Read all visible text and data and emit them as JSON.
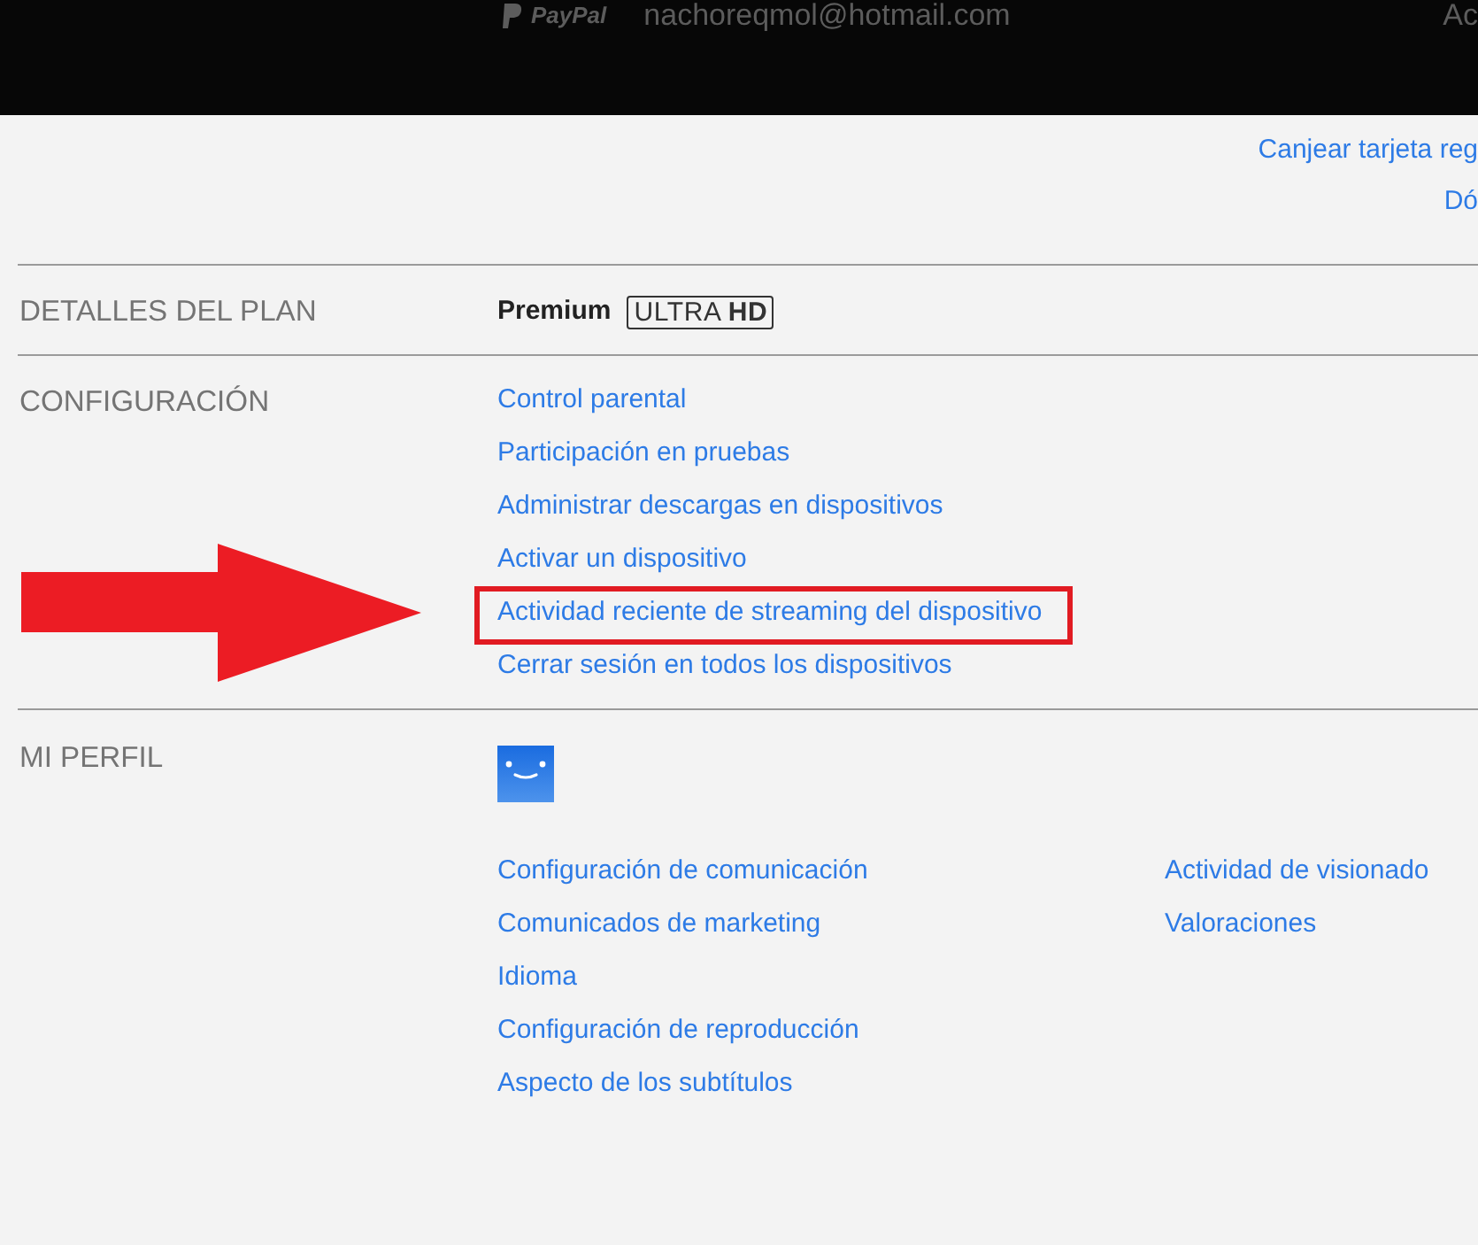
{
  "top_bar": {
    "payment_brand": "PayPal",
    "email": "nachoreqmol@hotmail.com",
    "cut_text": "Ac"
  },
  "account_links": [
    "Canjear tarjeta reg",
    "Dó"
  ],
  "plan": {
    "label": "DETALLES DEL PLAN",
    "name": "Premium",
    "badge": "ULTRA **HD**"
  },
  "settings": {
    "label": "CONFIGURACIÓN",
    "links": [
      {
        "text": "Control parental",
        "highlighted": false
      },
      {
        "text": "Participación en pruebas",
        "highlighted": false
      },
      {
        "text": "Administrar descargas en dispositivos",
        "highlighted": false
      },
      {
        "text": "Activar un dispositivo",
        "highlighted": false
      },
      {
        "text": "Actividad reciente de streaming del dispositivo",
        "highlighted": true
      },
      {
        "text": "Cerrar sesión en todos los dispositivos",
        "highlighted": false
      }
    ]
  },
  "profile": {
    "label": "MI PERFIL",
    "left_links": [
      "Configuración de comunicación",
      "Comunicados de marketing",
      "Idioma",
      "Configuración de reproducción",
      "Aspecto de los subtítulos"
    ],
    "right_links": [
      "Actividad de visionado",
      "Valoraciones"
    ]
  }
}
